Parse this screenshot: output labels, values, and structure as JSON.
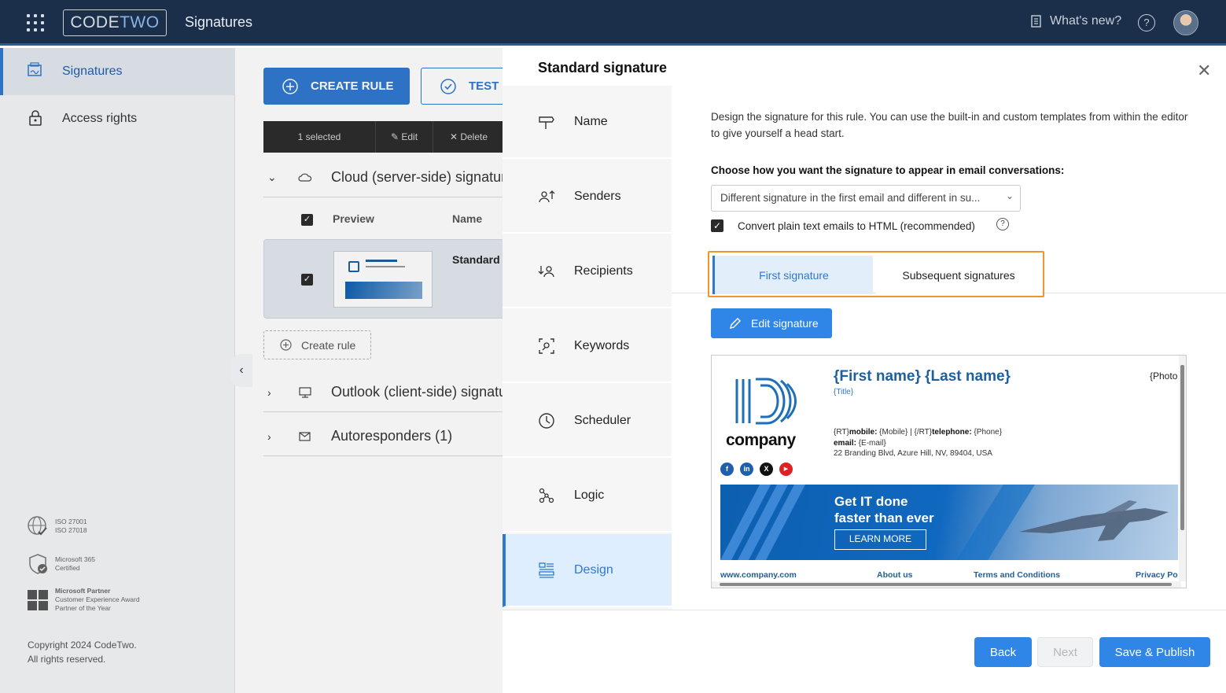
{
  "topbar": {
    "logo_code": "CODE",
    "logo_two": "TWO",
    "app_title": "Signatures",
    "whats_new": "What's new?",
    "help": "?"
  },
  "sidebar": {
    "items": [
      {
        "label": "Signatures",
        "icon": "signatures-icon",
        "active": true
      },
      {
        "label": "Access rights",
        "icon": "lock-icon",
        "active": false
      }
    ],
    "certs": [
      {
        "line1": "ISO 27001",
        "line2": "ISO 27018",
        "line3": ""
      },
      {
        "line1": "Microsoft 365",
        "line2": "Certified",
        "line3": ""
      },
      {
        "line1": "Microsoft Partner",
        "line2": "Customer Experience Award",
        "line3": "Partner of the Year"
      }
    ],
    "copyright_1": "Copyright 2024 CodeTwo.",
    "copyright_2": "All rights reserved."
  },
  "main": {
    "create_rule": "CREATE RULE",
    "test": "TEST",
    "selection": {
      "selected": "1 selected",
      "edit": "Edit",
      "delete": "Delete"
    },
    "groups": [
      {
        "label": "Cloud (server-side) signatures",
        "expanded": true
      },
      {
        "label": "Outlook (client-side) signatures",
        "expanded": false
      },
      {
        "label": "Autoresponders (1)",
        "expanded": false
      }
    ],
    "columns": {
      "preview": "Preview",
      "name": "Name"
    },
    "rule_name": "Standard",
    "create_rule_small": "Create rule"
  },
  "panel": {
    "title": "Standard signature",
    "steps": [
      {
        "label": "Name",
        "icon": "signpost-icon"
      },
      {
        "label": "Senders",
        "icon": "senders-icon"
      },
      {
        "label": "Recipients",
        "icon": "recipients-icon"
      },
      {
        "label": "Keywords",
        "icon": "keywords-icon"
      },
      {
        "label": "Scheduler",
        "icon": "clock-icon"
      },
      {
        "label": "Logic",
        "icon": "logic-icon"
      },
      {
        "label": "Design",
        "icon": "design-icon",
        "active": true
      }
    ],
    "intro": "Design the signature for this rule. You can use the built-in and custom templates from within the editor to give yourself a head start.",
    "choose_label": "Choose how you want the signature to appear in email conversations:",
    "dropdown_value": "Different signature in the first email and different in su...",
    "convert_label": "Convert plain text emails to HTML (recommended)",
    "tabs": {
      "first": "First signature",
      "second": "Subsequent signatures"
    },
    "edit_signature": "Edit signature",
    "signature": {
      "company": "company",
      "name": "{First name} {Last name}",
      "title": "{Title}",
      "photo": "{Photo",
      "line_phone": "{RT}mobile: {Mobile}  |  {/RT}telephone: {Phone}",
      "phone_rt1": "{RT}",
      "phone_mobile_label": "mobile:",
      "phone_mobile_val": " {Mobile}  |  {/RT}",
      "phone_tel_label": "telephone:",
      "phone_tel_val": " {Phone}",
      "email_label": "email:",
      "email_val": " {E-mail}",
      "address": "22 Branding Blvd, Azure Hill, NV, 89404, USA",
      "banner_line1": "Get IT done",
      "banner_line2": "faster than ever",
      "learn_more": "LEARN MORE",
      "links": [
        "www.company.com",
        "About us",
        "Terms and Conditions",
        "Privacy Po"
      ],
      "social": [
        {
          "name": "facebook-icon",
          "glyph": "f",
          "color": "#1f5fae"
        },
        {
          "name": "linkedin-icon",
          "glyph": "in",
          "color": "#1f5fae"
        },
        {
          "name": "x-icon",
          "glyph": "X",
          "color": "#111111"
        },
        {
          "name": "youtube-icon",
          "glyph": "▶",
          "color": "#e02020"
        }
      ]
    },
    "buttons": {
      "back": "Back",
      "next": "Next",
      "save": "Save & Publish"
    }
  },
  "colors": {
    "accent": "#2f78d1",
    "topbar": "#1b2f4a",
    "highlight": "#f0942f"
  }
}
